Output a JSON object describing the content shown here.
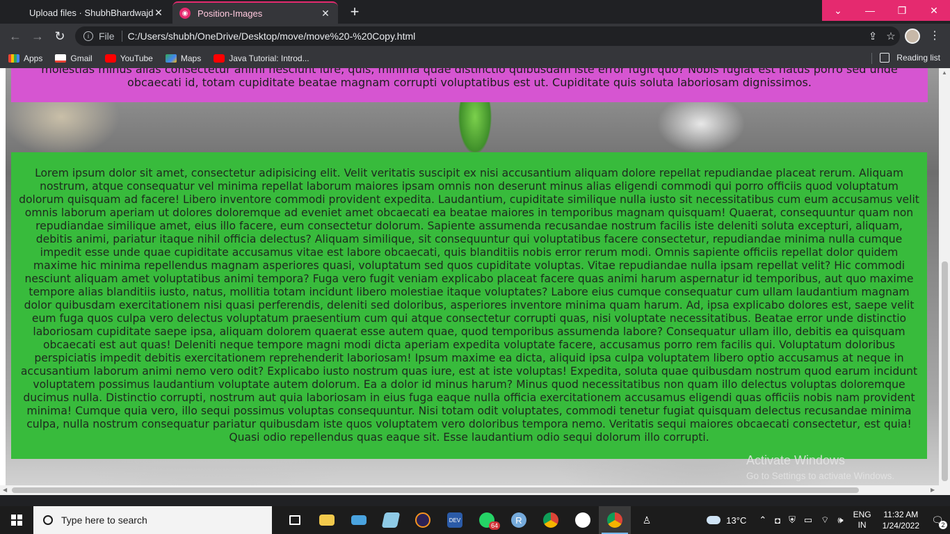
{
  "browser": {
    "tabs": [
      {
        "title": "Upload files · ShubhBhardwajddn",
        "active": false
      },
      {
        "title": "Position-Images",
        "active": true
      }
    ],
    "new_tab": "+",
    "window_controls": [
      "⌄",
      "—",
      "❐",
      "✕"
    ],
    "scheme": "File",
    "url": "C:/Users/shubh/OneDrive/Desktop/move/move%20-%20Copy.html",
    "bookmarks": [
      {
        "label": "Apps",
        "icon": "apps-grid-icon"
      },
      {
        "label": "Gmail",
        "icon": "gmail-icon"
      },
      {
        "label": "YouTube",
        "icon": "youtube-icon"
      },
      {
        "label": "Maps",
        "icon": "maps-icon"
      },
      {
        "label": "Java Tutorial: Introd...",
        "icon": "youtube-icon"
      }
    ],
    "reading_list": "Reading list"
  },
  "page": {
    "pink_text": "molestias minus alias consectetur animi nesciunt iure, quis, minima quae distinctio quibusdam iste error fugit quo? Nobis fugiat est natus porro sed unde obcaecati id, totam cupiditate beatae magnam corrupti voluptatibus est ut. Cupiditate quis soluta laboriosam dignissimos.",
    "green_text": "Lorem ipsum dolor sit amet, consectetur adipisicing elit. Velit veritatis suscipit ex nisi accusantium aliquam dolore repellat repudiandae placeat rerum. Aliquam nostrum, atque consequatur vel minima repellat laborum maiores ipsam omnis non deserunt minus alias eligendi commodi qui porro officiis quod voluptatum dolorum quisquam ad facere! Libero inventore commodi provident expedita. Laudantium, cupiditate similique nulla iusto sit necessitatibus cum eum accusamus velit omnis laborum aperiam ut dolores doloremque ad eveniet amet obcaecati ea beatae maiores in temporibus magnam quisquam! Quaerat, consequuntur quam non repudiandae similique amet, eius illo facere, eum consectetur dolorum. Sapiente assumenda recusandae nostrum facilis iste deleniti soluta excepturi, aliquam, debitis animi, pariatur itaque nihil officia delectus? Aliquam similique, sit consequuntur qui voluptatibus facere consectetur, repudiandae minima nulla cumque impedit esse unde quae cupiditate accusamus vitae est labore obcaecati, quis blanditiis nobis error rerum modi. Omnis sapiente officiis repellat dolor quidem maxime hic minima repellendus magnam asperiores quasi, voluptatum sed quos cupiditate voluptas. Vitae repudiandae nulla ipsam repellat velit? Hic commodi nesciunt aliquam amet voluptatibus animi tempora? Fuga vero fugit veniam explicabo placeat facere quas animi harum aspernatur id temporibus, aut quo maxime tempore alias blanditiis iusto, natus, mollitia totam incidunt libero molestiae itaque voluptates? Labore eius cumque consequatur cum ullam laudantium magnam dolor quibusdam exercitationem nisi quasi perferendis, deleniti sed doloribus, asperiores inventore minima quam harum. Ad, ipsa explicabo dolores est, saepe velit eum fuga quos culpa vero delectus voluptatum praesentium cum qui atque consectetur corrupti quas, nisi voluptate necessitatibus. Beatae error unde distinctio laboriosam cupiditate saepe ipsa, aliquam dolorem quaerat esse autem quae, quod temporibus assumenda labore? Consequatur ullam illo, debitis ea quisquam obcaecati est aut quas! Deleniti neque tempore magni modi dicta aperiam expedita voluptate facere, accusamus porro rem facilis qui. Voluptatum doloribus perspiciatis impedit debitis exercitationem reprehenderit laboriosam! Ipsum maxime ea dicta, aliquid ipsa culpa voluptatem libero optio accusamus at neque in accusantium laborum animi nemo vero odit? Explicabo iusto nostrum quas iure, est at iste voluptas! Expedita, soluta quae quibusdam nostrum quod earum incidunt voluptatem possimus laudantium voluptate autem dolorum. Ea a dolor id minus harum? Minus quod necessitatibus non quam illo delectus voluptas doloremque ducimus nulla. Distinctio corrupti, nostrum aut quia laboriosam in eius fuga eaque nulla officia exercitationem accusamus eligendi quas officiis nobis nam provident minima! Cumque quia vero, illo sequi possimus voluptas consequuntur. Nisi totam odit voluptates, commodi tenetur fugiat quisquam delectus recusandae minima culpa, nulla nostrum consequatur pariatur quibusdam iste quos voluptatem vero doloribus tempora nemo. Veritatis sequi maiores obcaecati consectetur, est quia! Quasi odio repellendus quas eaque sit. Esse laudantium odio sequi dolorum illo corrupti.",
    "activate_title": "Activate Windows",
    "activate_sub": "Go to Settings to activate Windows."
  },
  "taskbar": {
    "search_placeholder": "Type here to search",
    "apps": [
      {
        "name": "task-view",
        "color": "#ffffff"
      },
      {
        "name": "file-explorer",
        "color": "#f2c94c"
      },
      {
        "name": "this-pc",
        "color": "#4aa3df"
      },
      {
        "name": "notepad",
        "color": "#8ecae6"
      },
      {
        "name": "eclipse",
        "color": "#2c2255"
      },
      {
        "name": "dev-cpp",
        "color": "#2b5ba8"
      },
      {
        "name": "whatsapp",
        "color": "#25d366",
        "badge": "64"
      },
      {
        "name": "r-studio",
        "color": "#75aadb"
      },
      {
        "name": "chrome",
        "color": "#db4437"
      },
      {
        "name": "wps",
        "color": "#ffffff"
      },
      {
        "name": "chrome-active",
        "color": "#db4437",
        "active": true
      }
    ],
    "weather": "13°C",
    "lang_1": "ENG",
    "lang_2": "IN",
    "time": "11:32 AM",
    "date": "1/24/2022",
    "notifications": "2",
    "colors": {
      "accent": "#e52a6f",
      "pink_box": "#d655d1",
      "green_box": "#38bb3c"
    }
  }
}
